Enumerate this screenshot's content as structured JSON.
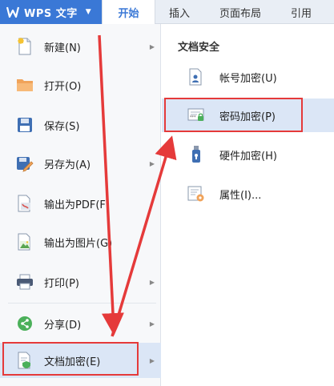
{
  "app": {
    "title": "WPS 文字"
  },
  "tabs": [
    {
      "label": "开始"
    },
    {
      "label": "插入"
    },
    {
      "label": "页面布局"
    },
    {
      "label": "引用"
    }
  ],
  "file_menu": {
    "items": [
      {
        "label": "新建(N)",
        "icon": "new-document-icon",
        "has_submenu": true
      },
      {
        "label": "打开(O)",
        "icon": "folder-open-icon",
        "has_submenu": false
      },
      {
        "label": "保存(S)",
        "icon": "save-icon",
        "has_submenu": false
      },
      {
        "label": "另存为(A)",
        "icon": "save-as-icon",
        "has_submenu": true
      },
      {
        "label": "输出为PDF(F)",
        "icon": "export-pdf-icon",
        "has_submenu": false
      },
      {
        "label": "输出为图片(G)",
        "icon": "export-image-icon",
        "has_submenu": false
      },
      {
        "label": "打印(P)",
        "icon": "printer-icon",
        "has_submenu": true
      },
      {
        "label": "分享(D)",
        "icon": "share-icon",
        "has_submenu": true
      },
      {
        "label": "文档加密(E)",
        "icon": "document-encrypt-icon",
        "has_submenu": true,
        "selected": true
      }
    ]
  },
  "submenu": {
    "title": "文档安全",
    "items": [
      {
        "label": "帐号加密(U)",
        "icon": "account-lock-icon"
      },
      {
        "label": "密码加密(P)",
        "icon": "password-lock-icon",
        "selected": true
      },
      {
        "label": "硬件加密(H)",
        "icon": "usb-key-icon"
      },
      {
        "label": "属性(I)...",
        "icon": "properties-icon"
      }
    ]
  },
  "colors": {
    "accent": "#3a78d6",
    "highlight": "#e53a3a",
    "selected_bg": "#dbe6f6"
  }
}
